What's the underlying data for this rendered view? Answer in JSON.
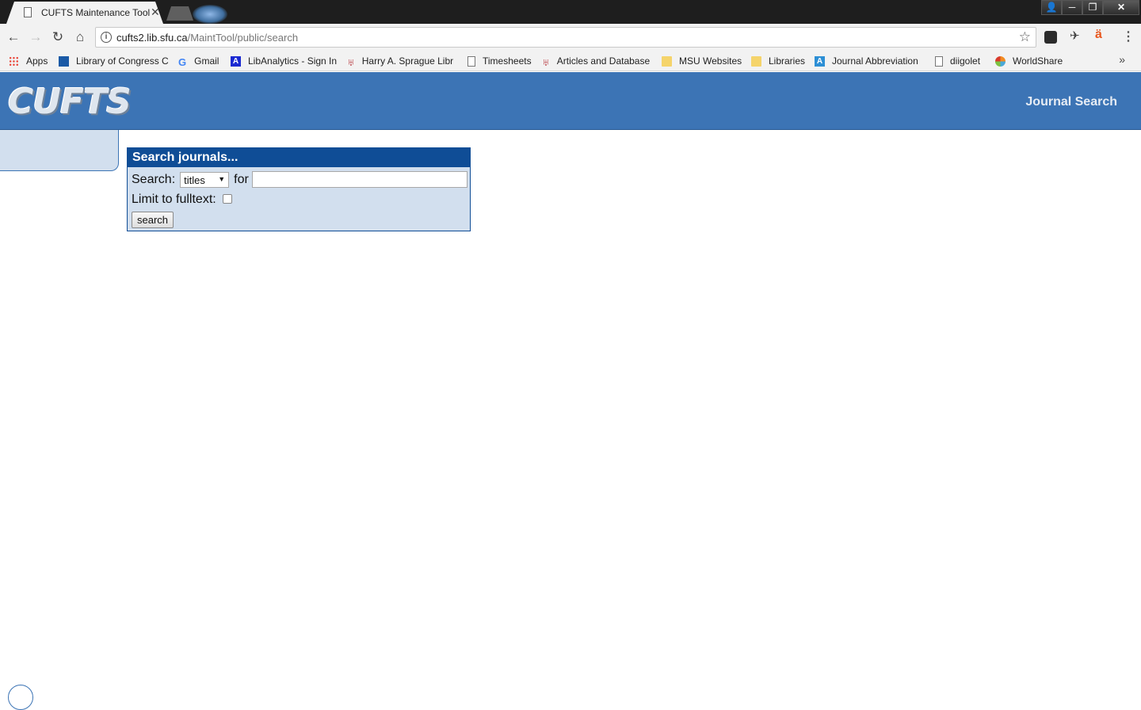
{
  "browser": {
    "tab_title": "CUFTS Maintenance Tool",
    "tab_close": "✕",
    "window_buttons": {
      "user": "👤",
      "minimize": "─",
      "maximize": "❐",
      "close": "✕"
    },
    "url_host": "cufts2.lib.sfu.ca",
    "url_path": "/MaintTool/public/search",
    "nav": {
      "back": "←",
      "forward": "→",
      "reload": "↻",
      "home": "⌂"
    },
    "star": "☆",
    "menu": "⋮",
    "bookmarks": [
      {
        "label": "Apps",
        "icon": "apps-icon"
      },
      {
        "label": "Library of Congress C",
        "icon": "book-icon"
      },
      {
        "label": "Gmail",
        "icon": "google-icon"
      },
      {
        "label": "LibAnalytics - Sign In",
        "icon": "libanalytics-icon"
      },
      {
        "label": "Harry A. Sprague Libr",
        "icon": "shield-icon"
      },
      {
        "label": "Timesheets",
        "icon": "page-icon"
      },
      {
        "label": "Articles and Database",
        "icon": "shield-icon"
      },
      {
        "label": "MSU Websites",
        "icon": "folder-icon"
      },
      {
        "label": "Libraries",
        "icon": "folder-icon"
      },
      {
        "label": "Journal Abbreviation",
        "icon": "journal-abbrev-icon"
      },
      {
        "label": "diigolet",
        "icon": "page-icon"
      },
      {
        "label": "WorldShare",
        "icon": "worldshare-icon"
      }
    ],
    "bookmarks_more": "»"
  },
  "header": {
    "logo_text": "CUFTS",
    "journal_search_link": "Journal Search",
    "color": "#3c74b5"
  },
  "search_form": {
    "heading": "Search journals...",
    "search_label": "Search:",
    "field_select_value": "titles",
    "for_label": "for",
    "query_value": "",
    "fulltext_label": "Limit to fulltext:",
    "fulltext_checked": false,
    "submit_label": "search",
    "heading_color": "#0f4d96",
    "panel_color": "#d2dfee"
  }
}
